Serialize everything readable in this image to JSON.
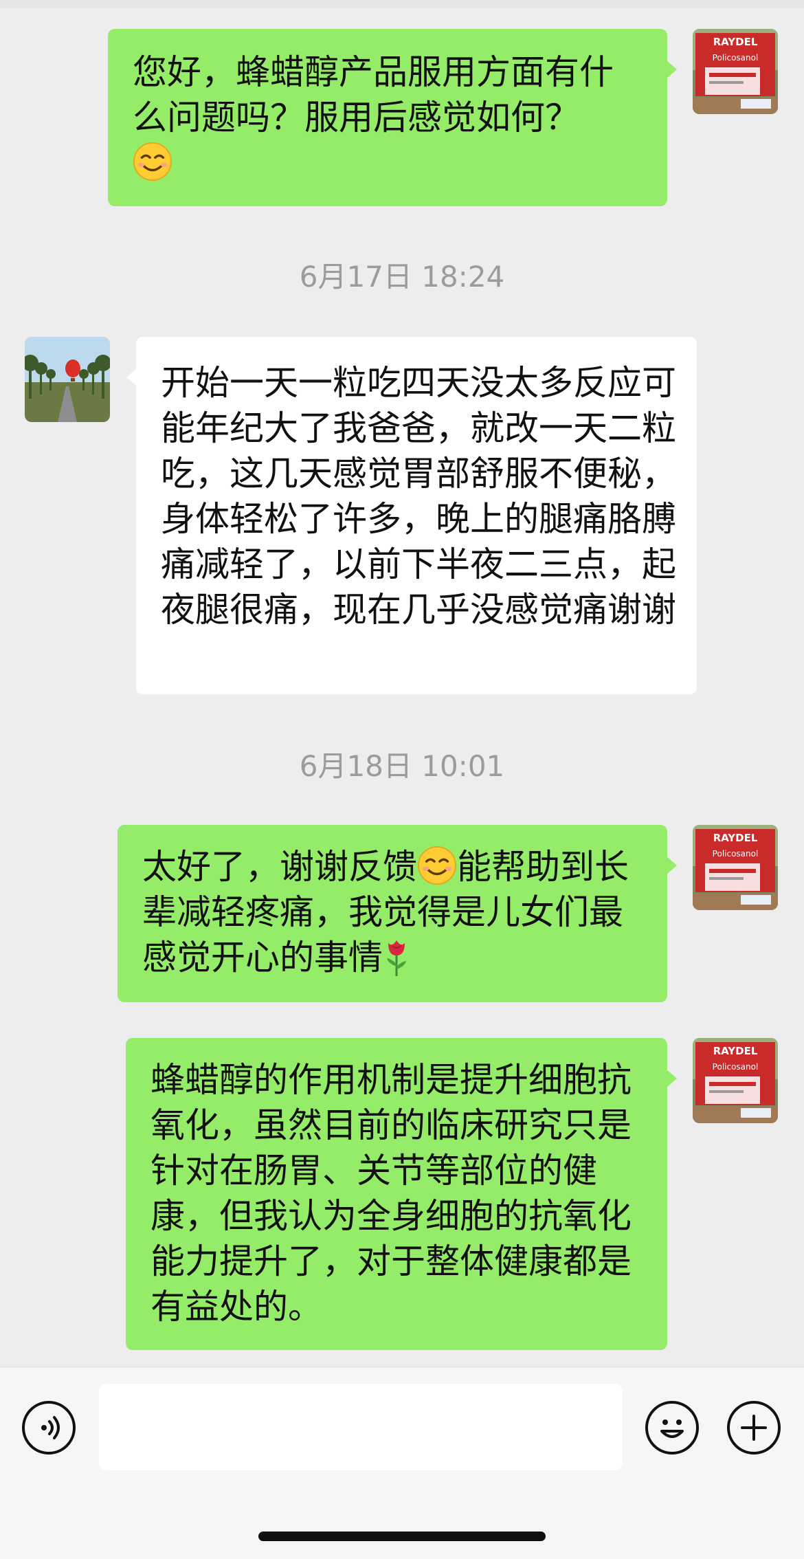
{
  "colors": {
    "outgoing_bubble": "#95ec69",
    "incoming_bubble": "#ffffff",
    "background": "#ededed",
    "timestamp_text": "#9b9b9b"
  },
  "product_avatar": {
    "brand_text": "RAYDEL",
    "product_text": "Policosanol"
  },
  "messages": [
    {
      "side": "outgoing",
      "text": "您好，蜂蜡醇产品服用方面有什么问题吗？服用后感觉如何？",
      "trailing_emoji": "smiling-face-emoji"
    },
    {
      "side": "incoming",
      "text": "开始一天一粒吃四天没太多反应可能年纪大了我爸爸，就改一天二粒吃，这几天感觉胃部舒服不便秘，身体轻松了许多，晚上的腿痛胳膊痛减轻了，以前下半夜二三点，起夜腿很痛，现在几乎没感觉痛谢谢"
    },
    {
      "side": "outgoing",
      "text_before": "太好了，谢谢反馈",
      "inline_emoji": "smiling-face-emoji",
      "text_after": "能帮助到长辈减轻疼痛，我觉得是儿女们最感觉开心的事情",
      "trailing_emoji": "rose-emoji"
    },
    {
      "side": "outgoing",
      "text": "蜂蜡醇的作用机制是提升细胞抗氧化，虽然目前的临床研究只是针对在肠胃、关节等部位的健康，但我认为全身细胞的抗氧化能力提升了，对于整体健康都是有益处的。"
    }
  ],
  "timestamps": [
    "6月17日 18:24",
    "6月18日 10:01"
  ],
  "input_bar": {
    "voice_icon": "voice-input-icon",
    "input_value": "",
    "emoji_icon": "emoji-icon",
    "plus_icon": "plus-icon"
  }
}
